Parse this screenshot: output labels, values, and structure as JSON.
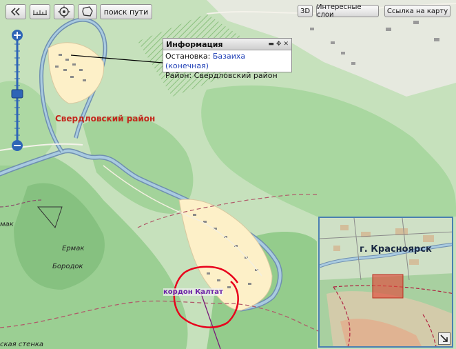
{
  "toolbar": {
    "search_route_label": "поиск пути",
    "btn_3d_label": "3D",
    "interesting_layers_label": "Интересные слои",
    "map_link_label": "Ссылка на карту"
  },
  "info_popup": {
    "title": "Информация",
    "stop_label": "Остановка:",
    "stop_value": "Базаиха (конечная)",
    "district_label": "Район:",
    "district_value": "Свердловский район"
  },
  "map_labels": {
    "district": "Свердловский район",
    "ermak": "Ермак",
    "borodok": "Бородок",
    "kordon": "кордон Калтат",
    "edge_top": "мак",
    "edge_bottom": "ская стенка"
  },
  "overview": {
    "city_label": "г. Красноярск"
  },
  "colors": {
    "forest": "#8fc88a",
    "forest_light": "#b5dba8",
    "river": "#a9cbe0",
    "river_edge": "#6f8fb0",
    "settlement": "#fdf0c8",
    "district_text": "#c4261c",
    "annotation_circle": "#e8001c",
    "slider_blue": "#2e65b6"
  }
}
